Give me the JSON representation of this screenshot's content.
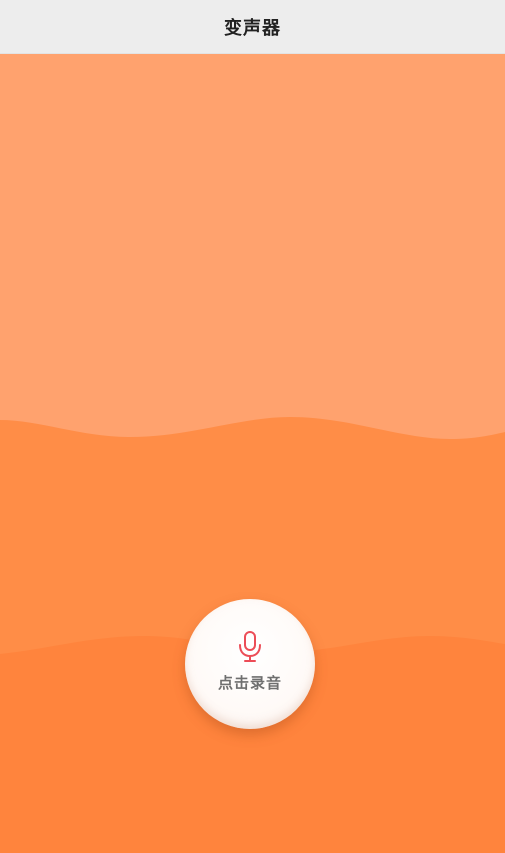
{
  "header": {
    "title": "变声器"
  },
  "record": {
    "label": "点击录音",
    "icon": "microphone-icon"
  },
  "colors": {
    "top_background": "#ffa26e",
    "wave_upper": "#ff8d47",
    "wave_lower": "#ff843d",
    "header_background": "#ededed",
    "mic_color": "#ec4d57"
  }
}
